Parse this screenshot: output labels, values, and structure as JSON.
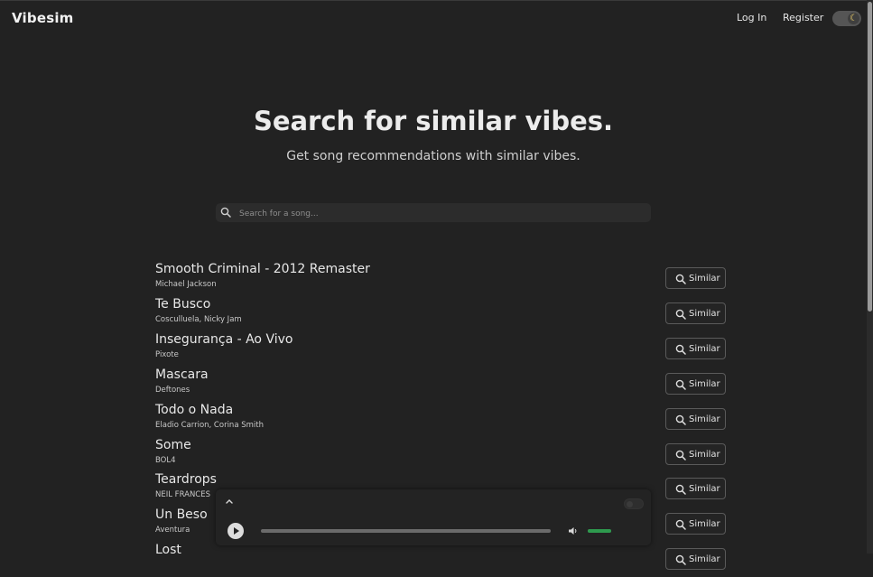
{
  "header": {
    "brand": "Vibesim",
    "login": "Log In",
    "register": "Register",
    "theme_icon": "moon-icon"
  },
  "hero": {
    "title": "Search for similar vibes.",
    "subtitle": "Get song recommendations with similar vibes."
  },
  "search": {
    "placeholder": "Search for a song...",
    "value": ""
  },
  "similar_label": "Similar",
  "songs": [
    {
      "title": "Smooth Criminal - 2012 Remaster",
      "artist": "Michael Jackson"
    },
    {
      "title": "Te Busco",
      "artist": "Cosculluela, Nicky Jam"
    },
    {
      "title": "Insegurança - Ao Vivo",
      "artist": "Pixote"
    },
    {
      "title": "Mascara",
      "artist": "Deftones"
    },
    {
      "title": "Todo o Nada",
      "artist": "Eladio Carrion, Corina Smith"
    },
    {
      "title": "Some",
      "artist": "BOL4"
    },
    {
      "title": "Teardrops",
      "artist": "NEIL FRANCES"
    },
    {
      "title": "Un Beso",
      "artist": "Aventura"
    },
    {
      "title": "Lost",
      "artist": ""
    }
  ],
  "player": {
    "progress": 0,
    "volume": 1.0,
    "accent": "#2e9a4e"
  }
}
